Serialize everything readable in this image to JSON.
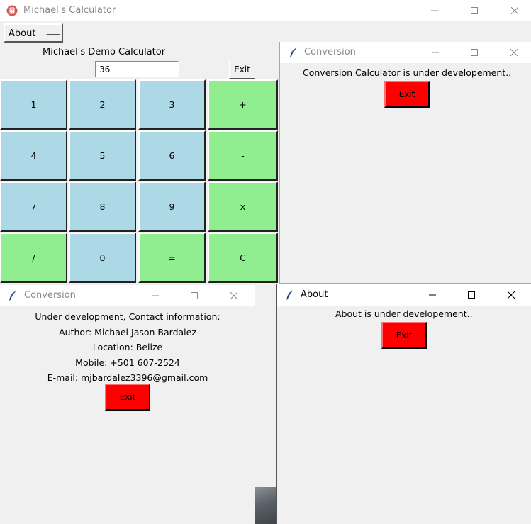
{
  "main": {
    "title": "Michael's Calculator",
    "menu_about": "About",
    "heading": "Michael's Demo Calculator",
    "display_value": "36",
    "exit_label": "Exit",
    "keys": [
      "1",
      "2",
      "3",
      "+",
      "4",
      "5",
      "6",
      "-",
      "7",
      "8",
      "9",
      "x",
      "/",
      "0",
      "=",
      "C"
    ]
  },
  "conversion_top": {
    "title": "Conversion",
    "message": "Conversion Calculator is under developement..",
    "exit_label": "Exit"
  },
  "conversion_bottom": {
    "title": "Conversion",
    "lines": [
      "Under development, Contact information:",
      "Author: Michael Jason Bardalez",
      "Location: Belize",
      "Mobile: +501 607-2524",
      "E-mail: mjbardalez3396@gmail.com"
    ],
    "exit_label": "Exit"
  },
  "about_window": {
    "title": "About",
    "message": "About is under developement..",
    "exit_label": "Exit"
  },
  "colors": {
    "digit_key": "#add8e6",
    "operator_key": "#90ee90",
    "exit_button": "#ff0000"
  }
}
